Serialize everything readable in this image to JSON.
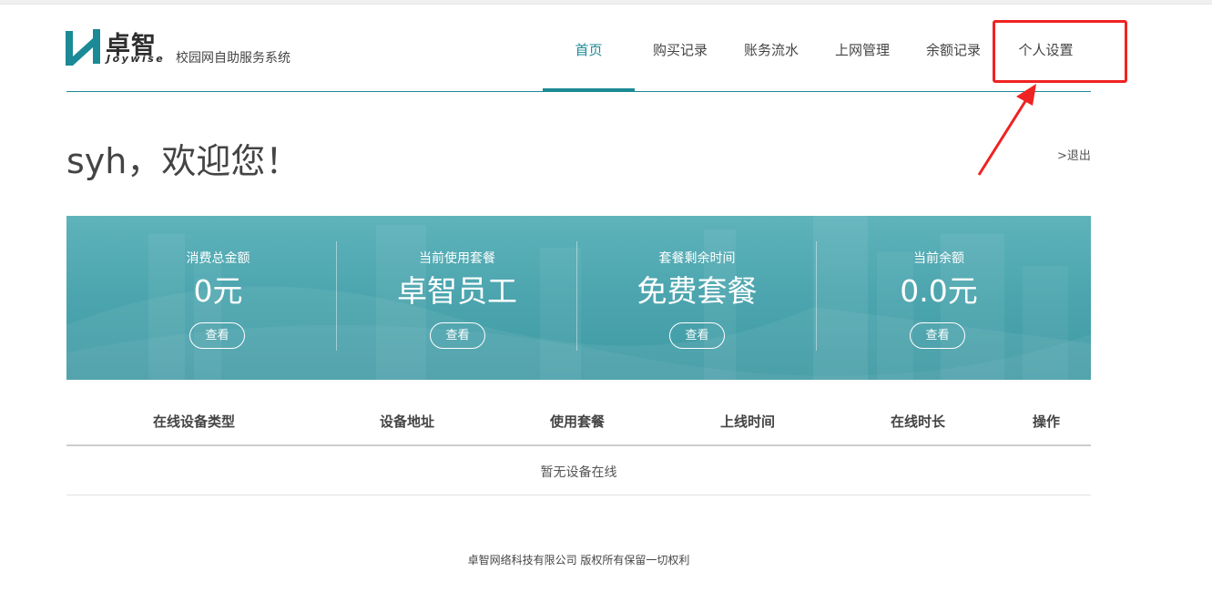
{
  "colors": {
    "accent": "#1b8a96",
    "annotation": "#f02222",
    "banner": "#4da6af"
  },
  "logo": {
    "name_cn": "卓智",
    "name_en": "Joywise",
    "subtitle": "校园网自助服务系统",
    "icon": "joywise-logo-icon"
  },
  "nav": {
    "items": [
      {
        "label": "首页",
        "active": true
      },
      {
        "label": "购买记录",
        "active": false
      },
      {
        "label": "账务流水",
        "active": false
      },
      {
        "label": "上网管理",
        "active": false
      },
      {
        "label": "余额记录",
        "active": false
      },
      {
        "label": "个人设置",
        "active": false
      }
    ]
  },
  "welcome": {
    "text": "syh，欢迎您！",
    "logout": ">退出"
  },
  "stats": [
    {
      "label": "消费总金额",
      "value": "0元",
      "button": "查看"
    },
    {
      "label": "当前使用套餐",
      "value": "卓智员工",
      "button": "查看"
    },
    {
      "label": "套餐剩余时间",
      "value": "免费套餐",
      "button": "查看"
    },
    {
      "label": "当前余额",
      "value": "0.0元",
      "button": "查看"
    }
  ],
  "table": {
    "headers": [
      "在线设备类型",
      "设备地址",
      "使用套餐",
      "上线时间",
      "在线时长",
      "操作"
    ],
    "empty": "暂无设备在线"
  },
  "footer": {
    "text": "卓智网络科技有限公司 版权所有保留一切权利"
  }
}
